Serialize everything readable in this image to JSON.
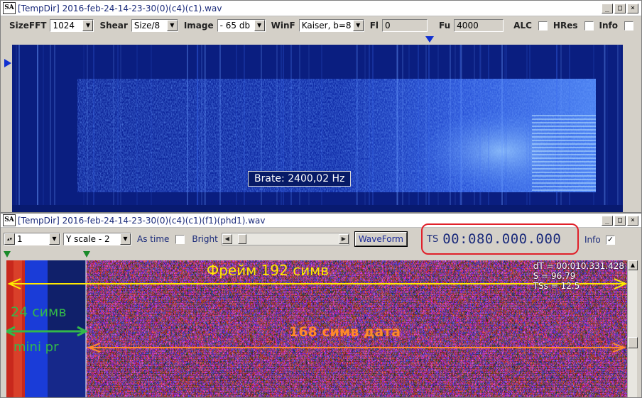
{
  "window1": {
    "title": "[TempDir] 2016-feb-24-14-23-30(0)(c4)(c1).wav",
    "toolbar": {
      "sizefft_label": "SizeFFT",
      "sizefft_value": "1024",
      "shear_label": "Shear",
      "shear_value": "Size/8",
      "image_label": "Image",
      "image_value": "- 65 db",
      "winf_label": "WinF",
      "winf_value": "Kaiser, b=8",
      "fl_label": "Fl",
      "fl_value": "0",
      "fu_label": "Fu",
      "fu_value": "4000",
      "alc_label": "ALC",
      "hres_label": "HRes",
      "info_label": "Info"
    },
    "brate_label": "Brate: 2400,02 Hz"
  },
  "window2": {
    "title": "[TempDir] 2016-feb-24-14-23-30(0)(c4)(c1)(f1)(phd1).wav",
    "toolbar": {
      "spin_value": "1",
      "yscale_value": "Y scale - 2",
      "astime_label": "As time",
      "bright_label": "Bright",
      "waveform_label": "WaveForm",
      "ts_label": "TS",
      "ts_value": "00:080.000.000",
      "info_label": "Info"
    },
    "readout": {
      "dt": "dT = 00:010.331.428",
      "s": "S = 96.79",
      "tss": "TSs = 12.5"
    },
    "annotations": {
      "frame": "Фрейм 192 симв",
      "count24": "24 симв",
      "mini": "mini pr",
      "data168": "168 симв дата"
    }
  },
  "colors": {
    "annotation_yellow": "#ffea00",
    "annotation_green": "#33b84a",
    "annotation_orange": "#ff8a2a",
    "ts_highlight": "#e0202a",
    "spectrum_blue": "#0a1e80"
  },
  "icons": [
    "app-icon",
    "minimize-icon",
    "maximize-icon",
    "close-icon",
    "chevron-down-icon",
    "arrow-left-icon",
    "arrow-right-icon",
    "arrow-up-icon",
    "triangle-marker-icon"
  ]
}
